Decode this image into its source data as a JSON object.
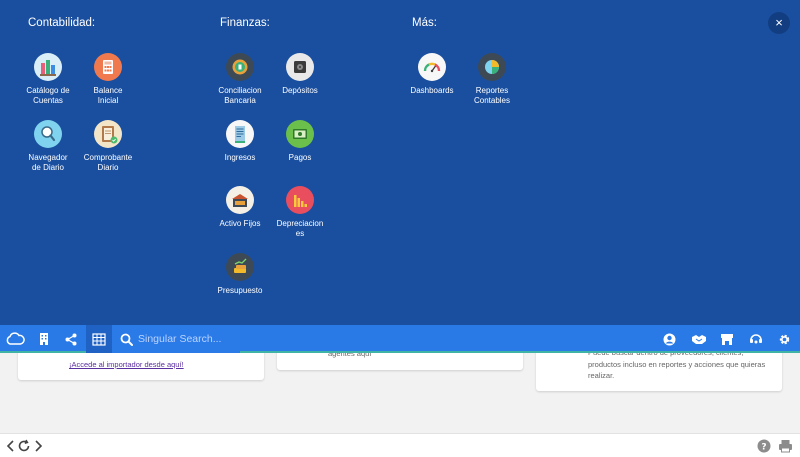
{
  "menu": {
    "close_label": "×",
    "columns": [
      {
        "title": "Contabilidad:"
      },
      {
        "title": "Finanzas:"
      },
      {
        "title": "Más:"
      }
    ],
    "items": {
      "catalogo": {
        "label1": "Catálogo de",
        "label2": "Cuentas",
        "icon": "chart-books-icon"
      },
      "balance": {
        "label1": "Balance",
        "label2": "Inicial",
        "icon": "calculator-icon"
      },
      "navegador": {
        "label1": "Navegador",
        "label2": "de Diario",
        "icon": "magnifier-icon"
      },
      "comprobante": {
        "label1": "Comprobante",
        "label2": "Diario",
        "icon": "journal-icon"
      },
      "conciliacion": {
        "label1": "Conciliacion",
        "label2": "Bancaria",
        "icon": "coin-icon"
      },
      "depositos": {
        "label1": "Depósitos",
        "label2": "",
        "icon": "safe-icon"
      },
      "ingresos": {
        "label1": "Ingresos",
        "label2": "",
        "icon": "receipt-icon"
      },
      "pagos": {
        "label1": "Pagos",
        "label2": "",
        "icon": "cash-icon"
      },
      "activo": {
        "label1": "Activo Fijos",
        "label2": "",
        "icon": "warehouse-icon"
      },
      "depreciaciones": {
        "label1": "Depreciacion",
        "label2": "es",
        "icon": "declining-chart-icon"
      },
      "presupuesto": {
        "label1": "Presupuesto",
        "label2": "",
        "icon": "money-chart-icon"
      },
      "dashboards": {
        "label1": "Dashboards",
        "label2": "",
        "icon": "gauge-icon"
      },
      "reportes": {
        "label1": "Reportes",
        "label2": "Contables",
        "icon": "pie-report-icon"
      }
    }
  },
  "background": {
    "card1_link": "¡Accede al importador desde aquí!",
    "card2_text": "agentes aquí",
    "card3_line1": "Puede buscar dentro de proveedores, clientes,",
    "card3_line2": "productos incluso en reportes y acciones que quieras",
    "card3_line3": "realizar."
  },
  "toolbar": {
    "search_placeholder": "Singular Search...",
    "colors": {
      "bar": "#2979e6",
      "accent": "#3fb4a6",
      "menu_bg": "#1a4fa0"
    }
  }
}
